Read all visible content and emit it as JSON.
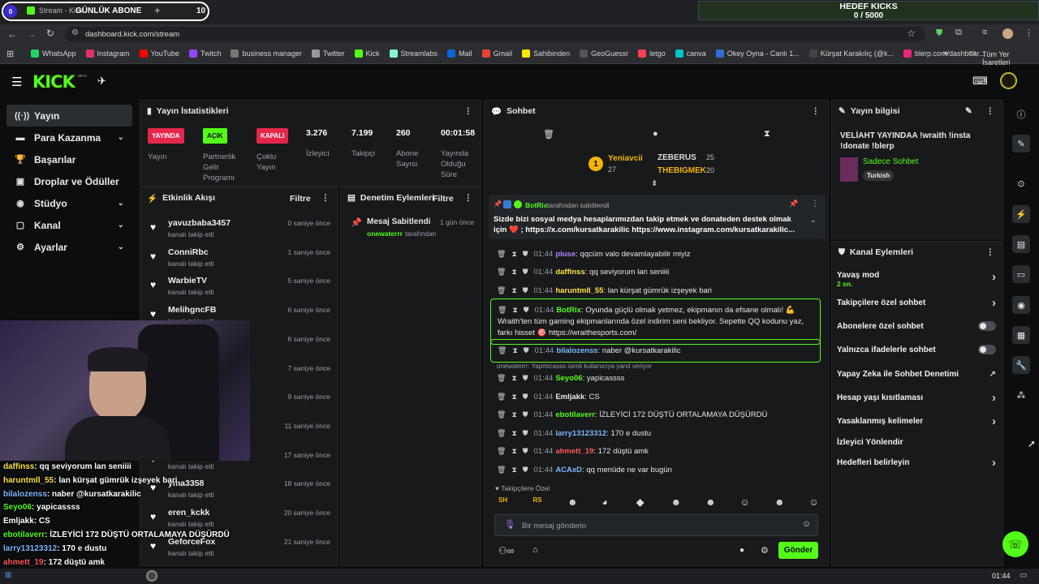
{
  "browser": {
    "tab_count_badge": "0",
    "tab_title": "Stream - Kick",
    "tab_overlay_text": "GÜNLÜK ABONE",
    "tab_overlay_count": "10",
    "new_tab": "+",
    "url": "dashboard.kick.com/stream",
    "kicks_title": "HEDEF KICKS",
    "kicks_value": "0 / 5000",
    "all_bookmarks": "Tüm Yer İşaretleri"
  },
  "bookmarks": [
    {
      "label": "WhatsApp",
      "color": "#25d366"
    },
    {
      "label": "Instagram",
      "color": "#e1306c"
    },
    {
      "label": "YouTube",
      "color": "#ff0000"
    },
    {
      "label": "Twitch",
      "color": "#9146ff"
    },
    {
      "label": "business manager",
      "color": "#777"
    },
    {
      "label": "Twitter",
      "color": "#999"
    },
    {
      "label": "Kick",
      "color": "#53fc18"
    },
    {
      "label": "Streamlabs",
      "color": "#80f5d2"
    },
    {
      "label": "Mail",
      "color": "#0a64d8"
    },
    {
      "label": "Gmail",
      "color": "#ea4335"
    },
    {
      "label": "Sahibinden",
      "color": "#ffe800"
    },
    {
      "label": "GeoGuessr",
      "color": "#555"
    },
    {
      "label": "letgo",
      "color": "#ff3f55"
    },
    {
      "label": "canva",
      "color": "#00c4cc"
    },
    {
      "label": "Okey Oyna - Canlı 1...",
      "color": "#2f6fd6"
    },
    {
      "label": "Kürşat Karakılıç (@k...",
      "color": "#444"
    },
    {
      "label": "blerp.com/dashboar...",
      "color": "#e7277a"
    }
  ],
  "nav": {
    "logo": "KICK",
    "beta": "BETA",
    "items": [
      {
        "label": "Yayın",
        "icon": "broadcast-icon"
      },
      {
        "label": "Para Kazanma",
        "icon": "money-icon"
      },
      {
        "label": "Başarılar",
        "icon": "trophy-icon"
      },
      {
        "label": "Droplar ve Ödüller",
        "icon": "gift-icon"
      },
      {
        "label": "Stüdyo",
        "icon": "studio-icon"
      },
      {
        "label": "Kanal",
        "icon": "channel-icon"
      },
      {
        "label": "Ayarlar",
        "icon": "settings-icon"
      }
    ]
  },
  "stats": {
    "title": "Yayın İstatistikleri",
    "live_badge": "YAYINDA",
    "live_label": "Yayın",
    "partner_badge": "AÇIK",
    "partner_label": "Partnerlik Gelir Programı",
    "multi_badge": "KAPALI",
    "multi_label": "Çoklu Yayın",
    "viewers_value": "3.276",
    "viewers_label": "İzleyici",
    "followers_value": "7.199",
    "followers_label": "Takipçi",
    "subs_value": "260",
    "subs_label": "Abone Sayısı",
    "uptime_value": "00:01:58",
    "uptime_label": "Yayında Olduğu Süre"
  },
  "activity": {
    "title": "Etkinlik Akışı",
    "filter": "Filtre",
    "events": [
      {
        "name": "yavuzbaba3457",
        "sub": "kanalı takip etti",
        "time": "0 saniye önce"
      },
      {
        "name": "ConniRbc",
        "sub": "kanalı takip etti",
        "time": "1 saniye önce"
      },
      {
        "name": "WarbieTV",
        "sub": "kanalı takip etti",
        "time": "5 saniye önce"
      },
      {
        "name": "MelihgncFB",
        "sub": "kanalı takip etti",
        "time": "6 saniye önce"
      },
      {
        "name": "",
        "sub": "",
        "time": "6 saniye önce"
      },
      {
        "name": "",
        "sub": "",
        "time": "7 saniye önce"
      },
      {
        "name": "",
        "sub": "",
        "time": "9 saniye önce"
      },
      {
        "name": "",
        "sub": "",
        "time": "11 saniye önce"
      },
      {
        "name": "",
        "sub": "kanalı takip etti",
        "time": "17 saniye önce"
      },
      {
        "name": "yma3358",
        "sub": "kanalı takip etti",
        "time": "18 saniye önce"
      },
      {
        "name": "eren_kckk",
        "sub": "kanalı takip etti",
        "time": "20 saniye önce"
      },
      {
        "name": "GeforceFox",
        "sub": "kanalı takip etti",
        "time": "21 saniye önce"
      }
    ]
  },
  "moderation": {
    "title": "Denetim Eylemleri",
    "filter": "Filtre",
    "item_title": "Mesaj Sabitlendi",
    "item_time": "1 gün önce",
    "item_user": "onewaterrr",
    "item_suffix": "tarafından"
  },
  "chat": {
    "title": "Sohbet",
    "leaders": [
      {
        "rank": "1",
        "name": "Yeniavcii",
        "count": "27"
      },
      {
        "name": "ZEBERUS",
        "count": "25"
      },
      {
        "name": "THEBIGMEK",
        "count": "20"
      }
    ],
    "pinned": {
      "user": "BotRix",
      "by": "tarafından sabitlendi",
      "text": "Sizde bizi sosyal medya hesaplarımızdan takip etmek ve donateden destek olmak için ❤️ ; https://x.com/kursatkarakilic https://www.instagram.com/kursatkarakilic..."
    },
    "messages": [
      {
        "time": "01:44",
        "user": "piuse",
        "color": "#b483ff",
        "text": "qqcüm valo devamlayabilir miyiz"
      },
      {
        "time": "01:44",
        "user": "daffinss",
        "color": "#ffe14a",
        "text": "qq seviyorum lan seniiii"
      },
      {
        "time": "01:44",
        "user": "haruntmll_55",
        "color": "#ffe14a",
        "text": "lan kürşat gümrük izşeyek bari"
      },
      {
        "time": "01:44",
        "user": "BotRix",
        "color": "#53fc18",
        "text": "Oyunda güçlü olmak yetmez, ekipmanın da efsane olmalı! 💪 Wraith'ten tüm gaming ekipmanlarında özel indirim seni bekliyor. Sepette QQ kodunu yaz, farkı hisset 🎯 https://wraithesports.com/"
      },
      {
        "time": "01:44",
        "user": "bilalozenss",
        "color": "#7fb6ff",
        "text": "naber @kursatkarakilic"
      },
      {
        "time": "01:44",
        "user": "Seyo06",
        "color": "#53fc18",
        "text": "yapicassss"
      },
      {
        "time": "01:44",
        "user": "Emljakk",
        "color": "#e6e8ea",
        "text": "CS"
      },
      {
        "time": "01:44",
        "user": "ebotilaverr",
        "color": "#53fc18",
        "text": "İZLEYİCİ 172 DÜŞTÜ ORTALAMAYA DÜŞÜRDÜ"
      },
      {
        "time": "01:44",
        "user": "larry13123312",
        "color": "#7fb6ff",
        "text": "170 e dustu"
      },
      {
        "time": "01:44",
        "user": "ahmett_19",
        "color": "#ff5757",
        "text": "172 düştü amk"
      },
      {
        "time": "01:44",
        "user": "ACAxD",
        "color": "#7fb6ff",
        "text": "qq menüde ne var bugün"
      }
    ],
    "reply_hint": "onewaterrr: Yapmicasss isimli kullanıcıya yanıt veriyor",
    "followers_only": "Takipçilere Özel",
    "placeholder": "Bir mesaj gönderin",
    "send": "Gönder"
  },
  "info": {
    "title": "Yayın bilgisi",
    "stream_title": "VELİAHT YAYINDAA !wraith !insta !donate !blerp",
    "category": "Sadece Sohbet",
    "lang": "Turkish"
  },
  "channel_actions": {
    "title": "Kanal Eylemleri",
    "items": [
      {
        "label": "Yavaş mod",
        "sub": "2 sn.",
        "type": "chevron"
      },
      {
        "label": "Takipçilere özel sohbet",
        "type": "chevron"
      },
      {
        "label": "Abonelere özel sohbet",
        "type": "toggle"
      },
      {
        "label": "Yalnızca ifadelerle sohbet",
        "type": "toggle"
      },
      {
        "label": "Yapay Zeka ile Sohbet Denetimi",
        "type": "ext"
      },
      {
        "label": "Hesap yaşı kısıtlaması",
        "type": "chevron"
      },
      {
        "label": "Yasaklanmış kelimeler",
        "type": "chevron"
      },
      {
        "label": "İzleyici Yönlendir",
        "type": "none"
      },
      {
        "label": "Hedefleri belirleyin",
        "type": "chevron"
      }
    ]
  },
  "overlay_chat": [
    {
      "user": "daffinss",
      "text": ": qq seviyorum lan seniiii",
      "color": "#ffe14a"
    },
    {
      "user": "haruntmll_55",
      "text": ": lan kürşat gümrük izşeyek bari",
      "color": "#ffe14a"
    },
    {
      "user": "bilalozenss",
      "text": ": naber @kursatkarakilic",
      "color": "#7fb6ff"
    },
    {
      "user": "Seyo06",
      "text": ": yapicassss",
      "color": "#53fc18"
    },
    {
      "user": "Emljakk",
      "text": ": CS",
      "color": "#ffffff"
    },
    {
      "user": "ebotilaverr",
      "text": ": İZLEYİCİ 172 DÜŞTÜ ORTALAMAYA DÜŞÜRDÜ",
      "color": "#53fc18"
    },
    {
      "user": "larry13123312",
      "text": ": 170 e dustu",
      "color": "#7fb6ff"
    },
    {
      "user": "ahmett_19",
      "text": ": 172 düştü amk",
      "color": "#ff5757"
    },
    {
      "user": "ACAxD",
      "text": ": qq menüde ne var bugün",
      "color": "#7fb6ff"
    }
  ],
  "taskbar": {
    "clock": "01:44"
  }
}
